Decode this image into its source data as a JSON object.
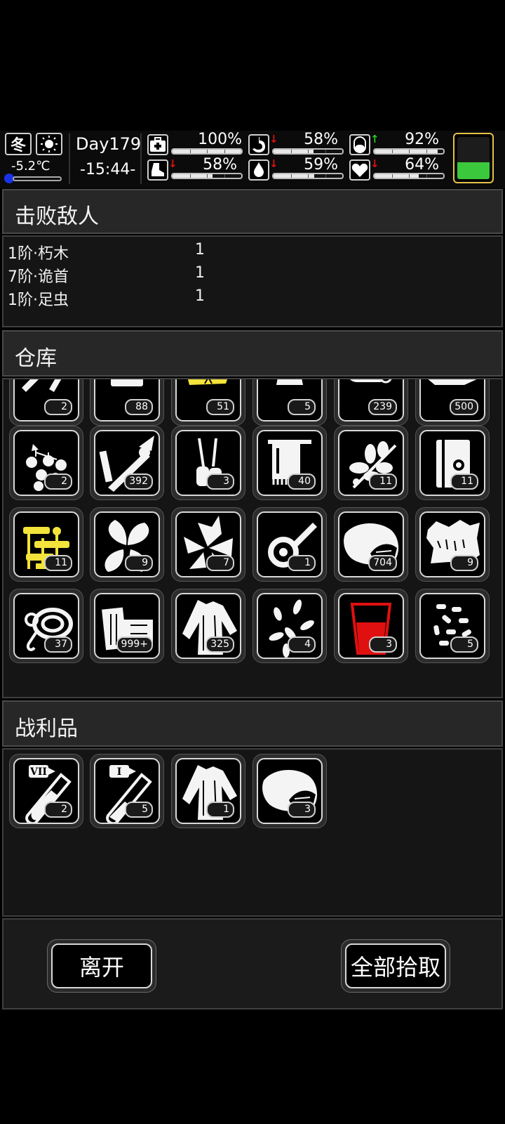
{
  "status": {
    "season": "冬",
    "temperature": "-5.2℃",
    "day": "Day179",
    "time": "-15:44-",
    "health": {
      "label": "100%",
      "value": 100
    },
    "stamina": {
      "label": "58%",
      "value": 58,
      "trend": "down"
    },
    "hunger": {
      "label": "58%",
      "value": 58,
      "trend": "down"
    },
    "thirst": {
      "label": "59%",
      "value": 59,
      "trend": "down"
    },
    "sanity": {
      "label": "92%",
      "value": 92,
      "trend": "up"
    },
    "mood": {
      "label": "64%",
      "value": 64,
      "trend": "down"
    },
    "battery_level": 40
  },
  "defeated": {
    "title": "击败敌人",
    "enemies": [
      {
        "name": "1阶·朽木",
        "count": "1"
      },
      {
        "name": "7阶·诡首",
        "count": "1"
      },
      {
        "name": "1阶·足虫",
        "count": "1"
      }
    ]
  },
  "warehouse": {
    "title": "仓库",
    "items": [
      {
        "icon": "tools-icon",
        "count": "2"
      },
      {
        "icon": "card-icon",
        "count": "88"
      },
      {
        "icon": "gold-fabric-icon",
        "count": "51"
      },
      {
        "icon": "grass-bundle-icon",
        "count": "5"
      },
      {
        "icon": "log-icon",
        "count": "239"
      },
      {
        "icon": "cloth-pile-icon",
        "count": "500"
      },
      {
        "icon": "berries-icon",
        "count": "2"
      },
      {
        "icon": "medical-tool-icon",
        "count": "392"
      },
      {
        "icon": "ampoule-icon",
        "count": "3"
      },
      {
        "icon": "towel-icon",
        "count": "40"
      },
      {
        "icon": "leaf-branch-icon",
        "count": "11"
      },
      {
        "icon": "book-icon",
        "count": "11"
      },
      {
        "icon": "gold-parts-icon",
        "count": "11"
      },
      {
        "icon": "leaves-icon",
        "count": "9"
      },
      {
        "icon": "mint-icon",
        "count": "7"
      },
      {
        "icon": "wrench-icon",
        "count": "1"
      },
      {
        "icon": "meat-icon",
        "count": "704"
      },
      {
        "icon": "fur-icon",
        "count": "9"
      },
      {
        "icon": "rope-icon",
        "count": "37"
      },
      {
        "icon": "planks-icon",
        "count": "999+"
      },
      {
        "icon": "shirt-icon",
        "count": "325"
      },
      {
        "icon": "seeds-icon",
        "count": "4"
      },
      {
        "icon": "red-cup-icon",
        "count": "3"
      },
      {
        "icon": "pills-icon",
        "count": "5"
      }
    ]
  },
  "loot": {
    "title": "战利品",
    "items": [
      {
        "icon": "test-tube-vii-icon",
        "count": "2",
        "tier": "VII"
      },
      {
        "icon": "test-tube-i-icon",
        "count": "5",
        "tier": "I"
      },
      {
        "icon": "shirt-icon",
        "count": "1"
      },
      {
        "icon": "meat-icon",
        "count": "3"
      }
    ]
  },
  "buttons": {
    "leave": "离开",
    "take_all": "全部拾取"
  },
  "colors": {
    "gold": "#f3e33a",
    "red": "#e01010",
    "battery": "#3cc83c",
    "arrow_up": "#22cc22",
    "arrow_down": "#dd1111"
  }
}
